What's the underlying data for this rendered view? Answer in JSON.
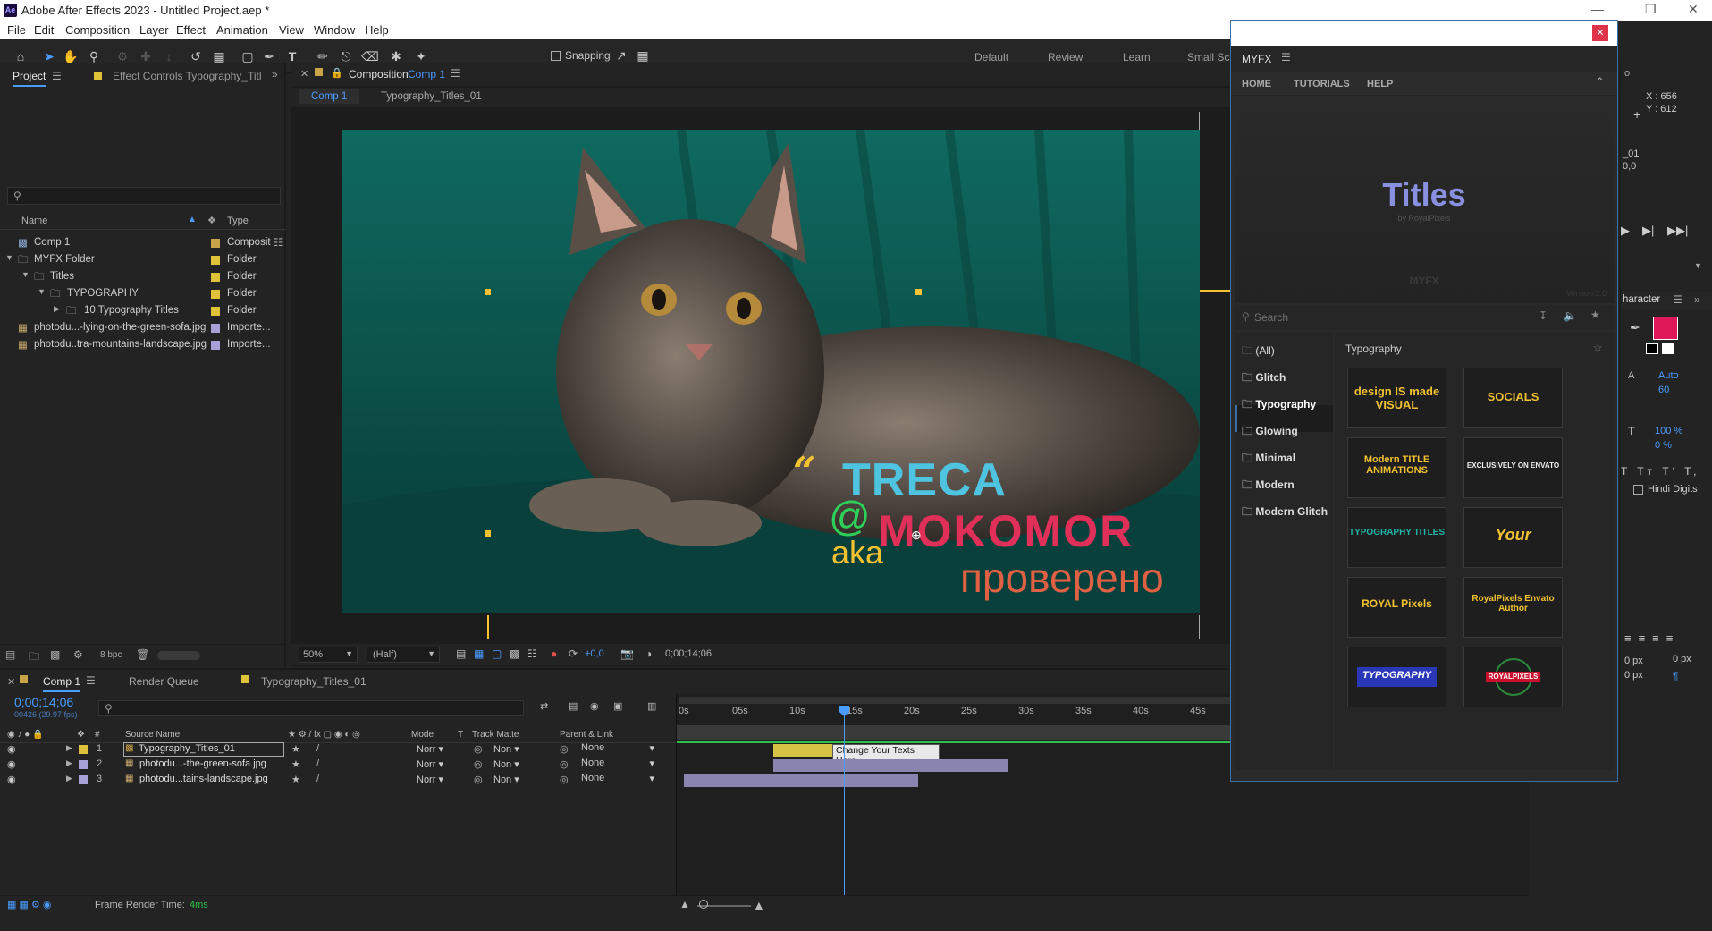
{
  "window": {
    "app_icon": "Ae",
    "title": "Adobe After Effects 2023 - Untitled Project.aep *"
  },
  "menu": [
    "File",
    "Edit",
    "Composition",
    "Layer",
    "Effect",
    "Animation",
    "View",
    "Window",
    "Help"
  ],
  "toolbar": {
    "snapping": "Snapping",
    "workspaces": [
      "Default",
      "Review",
      "Learn",
      "Small Scr"
    ]
  },
  "project": {
    "tab_project": "Project",
    "tab_effects": "Effect Controls Typography_Titl",
    "col_name": "Name",
    "col_type": "Type",
    "items": [
      {
        "name": "Comp 1",
        "type": "Composit",
        "color": "#c9a24a",
        "indent": 0
      },
      {
        "name": "MYFX Folder",
        "type": "Folder",
        "color": "#e0c23a",
        "indent": 0
      },
      {
        "name": "Titles",
        "type": "Folder",
        "color": "#e0c23a",
        "indent": 1
      },
      {
        "name": "TYPOGRAPHY",
        "type": "Folder",
        "color": "#e0c23a",
        "indent": 2
      },
      {
        "name": "10 Typography Titles",
        "type": "Folder",
        "color": "#e0c23a",
        "indent": 3
      },
      {
        "name": "photodu...-lying-on-the-green-sofa.jpg",
        "type": "Importe...",
        "color": "#a7a1d8",
        "indent": 0
      },
      {
        "name": "photodu..tra-mountains-landscape.jpg",
        "type": "Importe...",
        "color": "#a7a1d8",
        "indent": 0
      }
    ],
    "bpc": "8 bpc"
  },
  "composition": {
    "tab_label": "Composition",
    "comp_name": "Comp 1",
    "breadcrumb_1": "Comp 1",
    "breadcrumb_2": "Typography_Titles_01",
    "zoom": "50%",
    "resolution": "(Half)",
    "exposure": "+0,0",
    "timecode": "0;00;14;06"
  },
  "overlay": {
    "quote": "“",
    "line1": "TRECA",
    "at": "@",
    "line2": "MOKOMOR",
    "aka": "aka",
    "line3": "проверено"
  },
  "info": {
    "x": "X : 656",
    "y": "Y : 612",
    "layer": "_01",
    "value": "0,0"
  },
  "character": {
    "title": "haracter",
    "leading": "Auto",
    "tracking": "60",
    "vscale": "100 %",
    "baseline": "0 %",
    "hindi": "Hindi Digits",
    "px1": "0 px",
    "px2": "0 px"
  },
  "timeline": {
    "tab_comp": "Comp 1",
    "tab_render": "Render Queue",
    "tab_typo": "Typography_Titles_01",
    "current_time": "0;00;14;06",
    "fps": "00426 (29.97 fps)",
    "cols": {
      "source": "Source Name",
      "mode": "Mode",
      "t": "T",
      "matte": "Track Matte",
      "parent": "Parent & Link"
    },
    "ruler": [
      "0s",
      "05s",
      "10s",
      "15s",
      "20s",
      "25s",
      "30s",
      "35s",
      "40s",
      "45s"
    ],
    "layers": [
      {
        "num": "1",
        "name": "Typography_Titles_01",
        "mode": "Norr",
        "matte": "Non",
        "parent": "None",
        "color": "#e0c23a"
      },
      {
        "num": "2",
        "name": "photodu...-the-green-sofa.jpg",
        "mode": "Norr",
        "matte": "Non",
        "parent": "None",
        "color": "#a7a1d8"
      },
      {
        "num": "3",
        "name": "photodu...tains-landscape.jpg",
        "mode": "Norr",
        "matte": "Non",
        "parent": "None",
        "color": "#a7a1d8"
      }
    ],
    "bar_label": "Change Your Texts Here",
    "render_label": "Frame Render Time:",
    "render_value": "4ms"
  },
  "myfx": {
    "title": "MYFX",
    "nav": [
      "HOME",
      "TUTORIALS",
      "HELP"
    ],
    "banner_title": "Titles",
    "banner_sub": "by RoyalPixels",
    "banner_logo": "MYFX",
    "version": "Version 1.0",
    "search_placeholder": "Search",
    "categories": [
      "(All)",
      "Glitch",
      "Typography",
      "Glowing",
      "Minimal",
      "Modern",
      "Modern Glitch"
    ],
    "section": "Typography",
    "thumbs": [
      {
        "text": "design IS made VISUAL",
        "fg": "#f2c230"
      },
      {
        "text": "SOCIALS",
        "fg": "#f2c230"
      },
      {
        "text": "Modern TITLE ANIMATIONS",
        "fg": "#f2c230"
      },
      {
        "text": "EXCLUSIVELY ON ENVATO",
        "fg": "#f0f0f0"
      },
      {
        "text": "TYPOGRAPHY TITLES",
        "fg": "#1fb5a8"
      },
      {
        "text": "Your",
        "fg": "#f2c230"
      },
      {
        "text": "ROYAL Pixels",
        "fg": "#f2c230"
      },
      {
        "text": "RoyalPixels Envato Author",
        "fg": "#f2c230"
      },
      {
        "text": "TYPOGRAPHY",
        "fg": "#ffffff"
      },
      {
        "text": "ROYALPIXELS",
        "fg": "#ffffff"
      }
    ]
  }
}
